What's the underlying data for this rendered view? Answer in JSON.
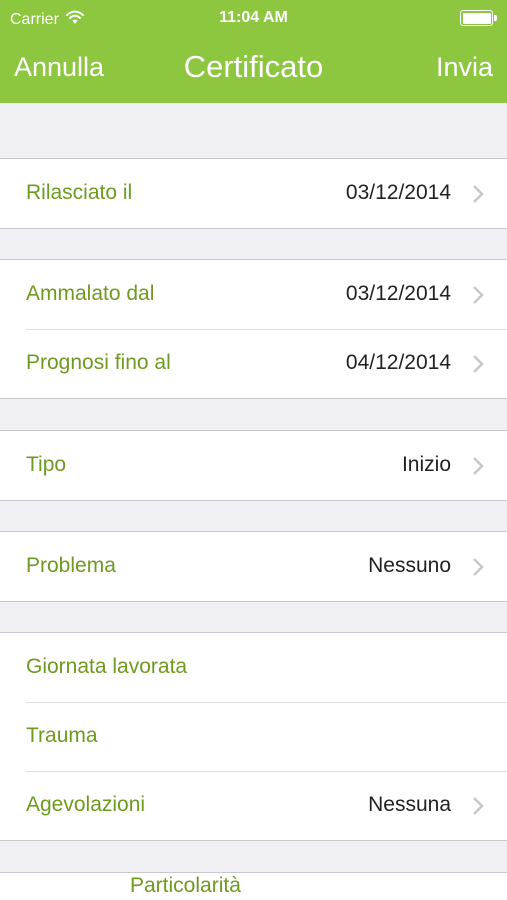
{
  "status_bar": {
    "carrier": "Carrier",
    "time": "11:04 AM"
  },
  "nav": {
    "cancel_label": "Annulla",
    "title": "Certificato",
    "send_label": "Invia"
  },
  "sections": [
    {
      "rows": [
        {
          "label": "Rilasciato il",
          "value": "03/12/2014"
        }
      ]
    },
    {
      "rows": [
        {
          "label": "Ammalato dal",
          "value": "03/12/2014"
        },
        {
          "label": "Prognosi fino al",
          "value": "04/12/2014"
        }
      ]
    },
    {
      "rows": [
        {
          "label": "Tipo",
          "value": "Inizio"
        }
      ]
    },
    {
      "rows": [
        {
          "label": "Problema",
          "value": "Nessuno"
        }
      ]
    },
    {
      "rows": [
        {
          "label": "Giornata lavorata"
        },
        {
          "label": "Trauma"
        },
        {
          "label": "Agevolazioni",
          "value": "Nessuna"
        }
      ]
    }
  ],
  "partial_row": {
    "label": "Particolarità"
  },
  "colors": {
    "accent": "#8dc63f",
    "label_green": "#6e9a1f",
    "background": "#efeff4"
  },
  "icons": {
    "wifi": "wifi-icon",
    "battery": "battery-icon",
    "chevron": "chevron-right-icon"
  }
}
